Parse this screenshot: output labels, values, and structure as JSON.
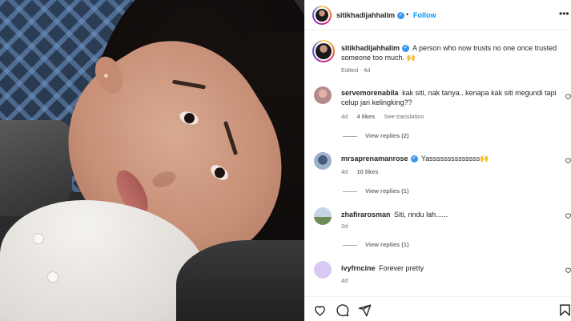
{
  "post": {
    "author": "sitikhadijahhalim",
    "follow_label": "Follow",
    "separator": "•",
    "more_glyph": "•••",
    "caption_text": "A person who now trusts no one once trusted someone too much. 🙌",
    "caption_edited": "Edited",
    "caption_time": "4d"
  },
  "comments": [
    {
      "username": "servemorenabila",
      "text": "kak siti, nak tanya.. kenapa kak siti megundi tapi celup jari kelingking??",
      "time": "4d",
      "likes": "4 likes",
      "extra": "See translation",
      "replies": "View replies (2)",
      "verified": false
    },
    {
      "username": "mrsaprenamanrose",
      "text": "Yassssssssssssss🙌",
      "time": "4d",
      "likes": "10 likes",
      "replies": "View replies (1)",
      "verified": true
    },
    {
      "username": "zhafirarosman",
      "text": "Siti, rindu lah......",
      "time": "2d",
      "replies": "View replies (1)",
      "verified": false
    },
    {
      "username": "ivyfrncine",
      "text": "Forever pretty",
      "time": "4d",
      "verified": false
    }
  ],
  "icons": {
    "like": "heart-icon",
    "comment": "comment-icon",
    "share": "send-icon",
    "save": "bookmark-icon"
  },
  "colors": {
    "accent": "#0095f6",
    "verified": "#3897f0",
    "muted": "#737373"
  }
}
